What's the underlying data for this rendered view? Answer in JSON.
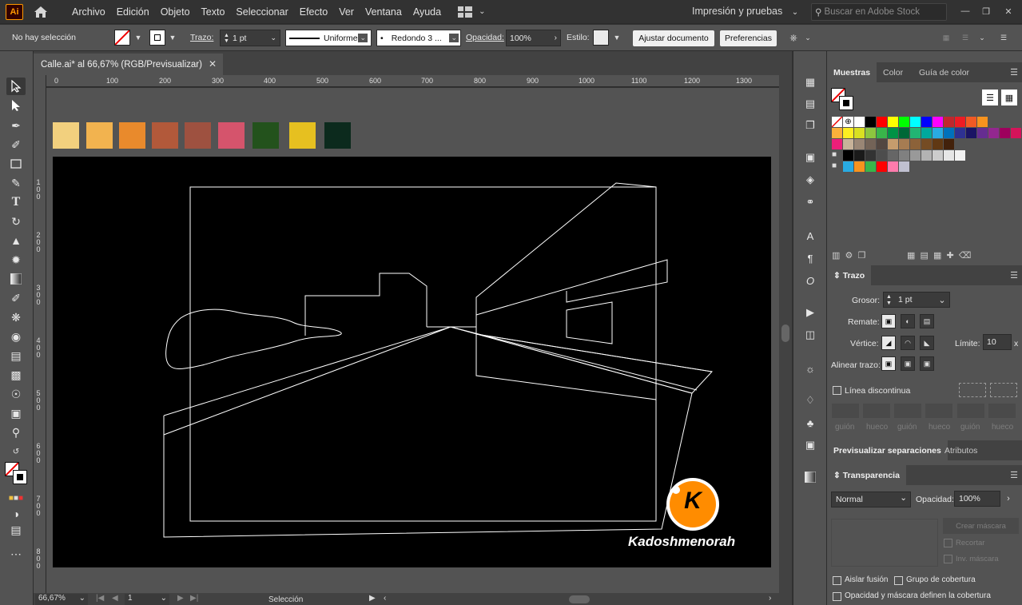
{
  "app": {
    "logo": "Ai"
  },
  "menu": [
    "Archivo",
    "Edición",
    "Objeto",
    "Texto",
    "Seleccionar",
    "Efecto",
    "Ver",
    "Ventana",
    "Ayuda"
  ],
  "workspace": "Impresión y pruebas",
  "search": {
    "placeholder": "Buscar en Adobe Stock"
  },
  "control": {
    "selection": "No hay selección",
    "stroke_label": "Trazo:",
    "stroke_value": "1 pt",
    "profile": "Uniforme",
    "brush": "Redondo 3 ...",
    "opacity_label": "Opacidad:",
    "opacity_value": "100%",
    "style_label": "Estilo:",
    "doc_setup": "Ajustar documento",
    "preferences": "Preferencias"
  },
  "tab": {
    "title": "Calle.ai* al 66,67% (RGB/Previsualizar)"
  },
  "ruler": {
    "h": [
      "0",
      "100",
      "200",
      "300",
      "400",
      "500",
      "600",
      "700",
      "800",
      "900",
      "1000",
      "1100",
      "1200",
      "1300"
    ],
    "v": [
      "1\n0\n0",
      "2\n0\n0",
      "3\n0\n0",
      "4\n0\n0",
      "5\n0\n0",
      "6\n0\n0",
      "7\n0\n0",
      "8\n0\n0"
    ]
  },
  "palette_chips": [
    "#f2d07e",
    "#f2b34f",
    "#e98a2c",
    "#b2593a",
    "#9e5140",
    "#d5546c",
    "#23521c",
    "#e6c020",
    "#0c2a1d"
  ],
  "watermark": {
    "letter": "K",
    "text": "Kadoshmenorah",
    "color": "#ff8c00"
  },
  "status": {
    "zoom": "66,67%",
    "page": "1",
    "tool": "Selección"
  },
  "panels": {
    "swatches_tabs": [
      "Muestras",
      "Color",
      "Guía de color"
    ],
    "swatch_rows": [
      [
        "#ffffff",
        "#000000",
        "#ff0000",
        "#ffff00",
        "#00ff00",
        "#00ffff",
        "#0000ff",
        "#ff00ff",
        "#c1272d",
        "#ed1c24",
        "#f15a24",
        "#f7931e"
      ],
      [
        "#fbb03b",
        "#fcee21",
        "#d9e021",
        "#8cc63f",
        "#39b54a",
        "#009245",
        "#006837",
        "#22b573",
        "#00a99d",
        "#29abe2",
        "#0071bc",
        "#2e3192",
        "#1b1464",
        "#662d91",
        "#93278f",
        "#9e005d",
        "#d4145a"
      ],
      [
        "#ed1e79",
        "#c7b299",
        "#998675",
        "#736357",
        "#534741",
        "#c69c6d",
        "#a67c52",
        "#8c6239",
        "#754c24",
        "#603813",
        "#42210b"
      ],
      [
        "#000000",
        "#1a1a1a",
        "#333333",
        "#4d4d4d",
        "#666666",
        "#808080",
        "#999999",
        "#b3b3b3",
        "#cccccc",
        "#e6e6e6",
        "#f2f2f2"
      ],
      [
        "#29abe2",
        "#f7931e",
        "#39b54a",
        "#ff0000",
        "#ff7bac",
        "#c0c0d0"
      ]
    ],
    "stroke": {
      "title": "Trazo",
      "weight_label": "Grosor:",
      "weight_value": "1 pt",
      "cap_label": "Remate:",
      "corner_label": "Vértice:",
      "limit_label": "Límite:",
      "limit_value": "10",
      "limit_unit": "x",
      "align_label": "Alinear trazo:",
      "dashed_label": "Línea discontinua",
      "dash_labels": [
        "guión",
        "hueco",
        "guión",
        "hueco",
        "guión",
        "hueco"
      ]
    },
    "sep_tabs": [
      "Previsualizar separaciones",
      "Atributos"
    ],
    "transparency": {
      "title": "Transparencia",
      "mode": "Normal",
      "opacity_label": "Opacidad:",
      "opacity_value": "100%",
      "make_mask": "Crear máscara",
      "clip": "Recortar",
      "invert": "Inv. máscara",
      "isolate": "Aislar fusión",
      "knockout": "Grupo de cobertura",
      "opacity_mask": "Opacidad y máscara definen la cobertura"
    }
  }
}
